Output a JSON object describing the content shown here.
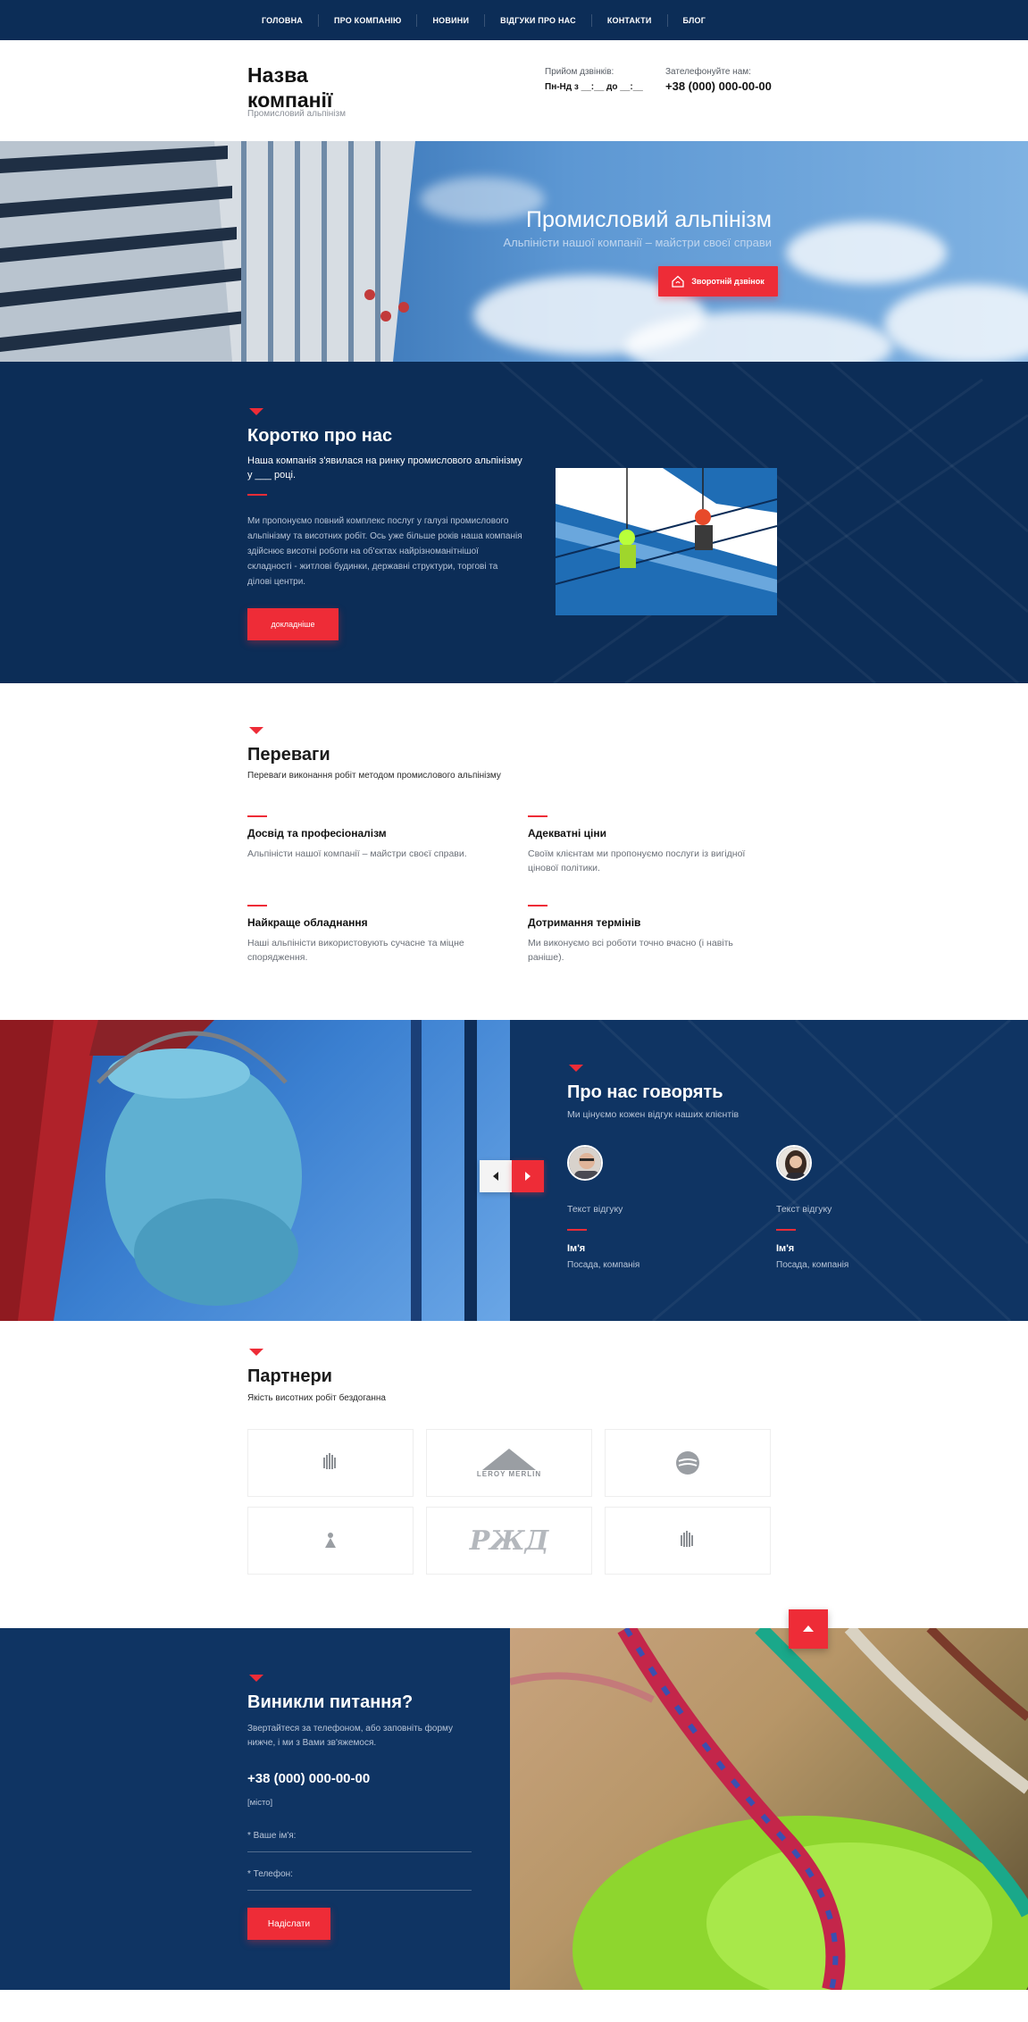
{
  "nav": {
    "items": [
      "Головна",
      "Про компанію",
      "Новини",
      "Відгуки про нас",
      "Контакти",
      "Блог"
    ]
  },
  "header": {
    "company_name": "Назва компанії",
    "company_tagline": "Промисловий альпінізм",
    "hours_label": "Прийом дзвінків:",
    "hours_value": "Пн-Нд з __:__ до __:__",
    "phone_label": "Зателефонуйте нам:",
    "phone_value": "+38 (000) 000-00-00"
  },
  "hero": {
    "title": "Промисловий альпінізм",
    "subtitle": "Альпіністи нашої компанії – майстри своєї справи",
    "callback_button": "Зворотній дзвінок"
  },
  "about": {
    "title": "Коротко про нас",
    "lead": "Наша компанія з'явилася на ринку промислового альпінізму у ___ році.",
    "body": "Ми пропонуємо повний комплекс послуг у галузі промислового альпінізму та висотних робіт. Ось уже більше років наша компанія здійснює висотні роботи на об'єктах найрізноманітнішої складності - житлові будинки, державні структури, торгові та ділові центри.",
    "more_button": "докладніше"
  },
  "advantages": {
    "title": "Переваги",
    "subtitle": "Переваги виконання робіт методом промислового альпінізму",
    "items": [
      {
        "title": "Досвід та професіоналізм",
        "text": "Альпіністи нашої компанії – майстри своєї справи."
      },
      {
        "title": "Адекватні ціни",
        "text": "Своїм клієнтам ми пропонуємо послуги із вигідної цінової політики."
      },
      {
        "title": "Найкраще обладнання",
        "text": "Наші альпіністи використовують сучасне та міцне спорядження."
      },
      {
        "title": "Дотримання термінів",
        "text": "Ми виконуємо всі роботи точно вчасно (і навіть раніше)."
      }
    ]
  },
  "reviews": {
    "title": "Про нас говорять",
    "subtitle": "Ми цінуємо кожен відгук наших клієнтів",
    "items": [
      {
        "text": "Текст відгуку",
        "name": "Ім'я",
        "position": "Посада, компанія"
      },
      {
        "text": "Текст відгуку",
        "name": "Ім'я",
        "position": "Посада, компанія"
      }
    ]
  },
  "partners": {
    "title": "Партнери",
    "subtitle": "Якість висотних робіт бездоганна",
    "logo_texts": {
      "leroy": "LEROY MERLIN",
      "rzd": "РЖД"
    }
  },
  "contact": {
    "title": "Виникли питання?",
    "text": "Звертайтеся за телефоном, або заповніть форму нижче, і ми з Вами зв'яжемося.",
    "phone": "+38 (000) 000-00-00",
    "city": "[місто]",
    "name_placeholder": "* Ваше ім'я:",
    "phone_placeholder": "* Телефон:",
    "submit": "Надіслати"
  },
  "colors": {
    "navy": "#0c2d57",
    "accent": "#ee2c37"
  },
  "icons": [
    "house-phone-icon",
    "arrow-left-icon",
    "arrow-right-icon",
    "arrow-up-icon"
  ]
}
